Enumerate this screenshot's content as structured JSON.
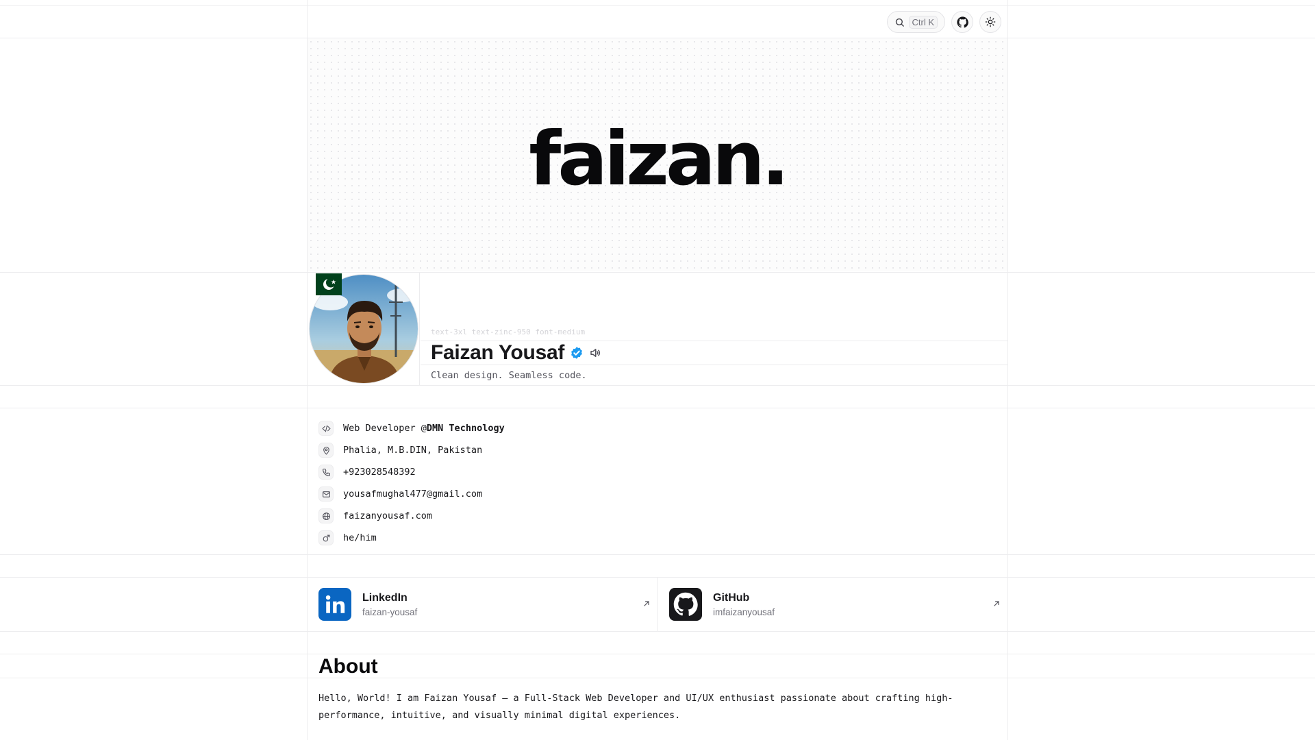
{
  "header": {
    "search_shortcut": "Ctrl K"
  },
  "hero": {
    "wordmark": "faizan."
  },
  "profile": {
    "code_hint": "text-3xl text-zinc-950 font-medium",
    "name": "Faizan Yousaf",
    "tagline": "Clean design. Seamless code."
  },
  "info": {
    "role_prefix": "Web Developer @",
    "company": "DMN Technology",
    "location": "Phalia, M.B.DIN, Pakistan",
    "phone": "+923028548392",
    "email": "yousafmughal477@gmail.com",
    "website": "faizanyousaf.com",
    "pronouns": "he/him"
  },
  "socials": [
    {
      "name": "LinkedIn",
      "handle": "faizan-yousaf"
    },
    {
      "name": "GitHub",
      "handle": "imfaizanyousaf"
    }
  ],
  "about": {
    "title": "About",
    "paragraph": "Hello, World! I am Faizan Yousaf — a Full-Stack Web Developer and UI/UX enthusiast passionate about crafting high-performance, intuitive, and visually minimal digital experiences."
  },
  "colors": {
    "linkedin": "#0a66c2",
    "github": "#18181b",
    "verified": "#1d9bf0",
    "flag_green": "#01411c"
  }
}
